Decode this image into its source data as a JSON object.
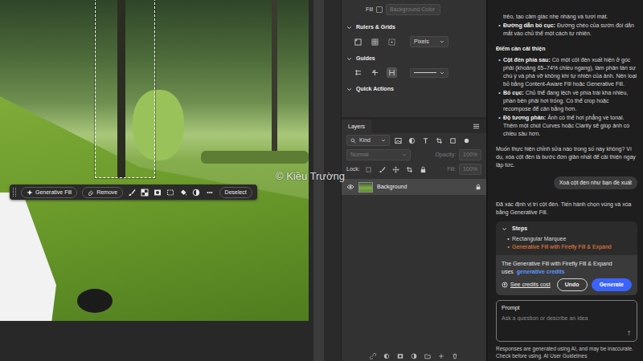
{
  "canvas": {
    "watermark": "© Kiều Trường",
    "selection_active": true
  },
  "taskbar": {
    "buttons": [
      "Generative Fill",
      "Remove"
    ],
    "more": "•••",
    "deselect": "Deselect"
  },
  "properties": {
    "fill_label": "Fill",
    "fill_checked": false,
    "fill_value": "Background Color",
    "sections": [
      {
        "title": "Rulers & Grids",
        "expanded": true,
        "kind": "rulers",
        "dropdown": "Pixels"
      },
      {
        "title": "Guides",
        "expanded": true,
        "kind": "guides"
      },
      {
        "title": "Quick Actions",
        "expanded": true,
        "kind": "plain"
      }
    ]
  },
  "layers": {
    "tab": "Layers",
    "filter": "Kind",
    "blend_mode": "Normal",
    "opacity_label": "Opacity:",
    "opacity": "100%",
    "lock_label": "Lock:",
    "fill_label": "Fill:",
    "fill": "100%",
    "items": [
      {
        "name": "Background",
        "visible": true,
        "locked": true,
        "selected": true
      }
    ]
  },
  "assistant": {
    "messages": [
      {
        "kind": "continuation",
        "text": "trẻo, tạo cảm giác nhẹ nhàng và tươi mát."
      },
      {
        "kind": "bullet",
        "marker": "•",
        "term": "Đường dẫn bố cục:",
        "text": "Đường chéo của sườn đồi dẫn mắt vào chủ thể một cách tự nhiên."
      },
      {
        "kind": "heading",
        "text": "Điểm cần cải thiện"
      },
      {
        "kind": "bullet",
        "marker": "•",
        "term": "Cột đèn phía sau:",
        "text": "Có một cột đèn xuất hiện ở góc phải (khoảng 65–74% chiều ngang), làm phân tán sự chú ý và phá vỡ không khí tự nhiên của ảnh. Nên loại bỏ bằng Content-Aware Fill hoặc Generative Fill."
      },
      {
        "kind": "bullet",
        "marker": "•",
        "term": "Bố cục:",
        "text": "Chủ thể đang lệch về phía trái khá nhiều, phần bên phải hơi trống. Có thể crop hoặc recompose để cân bằng hơn."
      },
      {
        "kind": "bullet",
        "marker": "•",
        "term": "Độ tương phản:",
        "text": "Ảnh có thể hơi phẳng về tonal. Thêm một chút Curves hoặc Clarity sẽ giúp ảnh có chiều sâu hơn."
      },
      {
        "kind": "paragraph",
        "text": "Muốn thực hiện chỉnh sửa nào trong số này không? Ví dụ, xóa cột đèn là bước đơn giản nhất để cải thiện ngay lập tức."
      },
      {
        "kind": "user",
        "text": "Xoá cột đèn như bạn đề xuất"
      },
      {
        "kind": "paragraph",
        "text": "Đã xác định vị trí cột đèn. Tiến hành chọn vùng và xóa bằng Generative Fill."
      }
    ],
    "steps": {
      "title": "Steps",
      "expanded": true,
      "items": [
        {
          "marker": "•",
          "text": "Rectangular Marquee",
          "selected": false
        },
        {
          "marker": "•",
          "text": "Generative Fill with Firefly Fill & Expand",
          "selected": true
        }
      ]
    },
    "credits": {
      "text": "The Generative Fill with Firefly Fill & Expand uses",
      "link": "generative credits",
      "cost": "See credits cost",
      "undo": "Undo",
      "generate": "Generate"
    },
    "prompt": {
      "label": "Prompt",
      "placeholder": "Ask a question or describe an idea",
      "send": "↑"
    },
    "footer": "Responses are generated using AI, and may be inaccurate. Check before using. AI User Guidelines"
  }
}
